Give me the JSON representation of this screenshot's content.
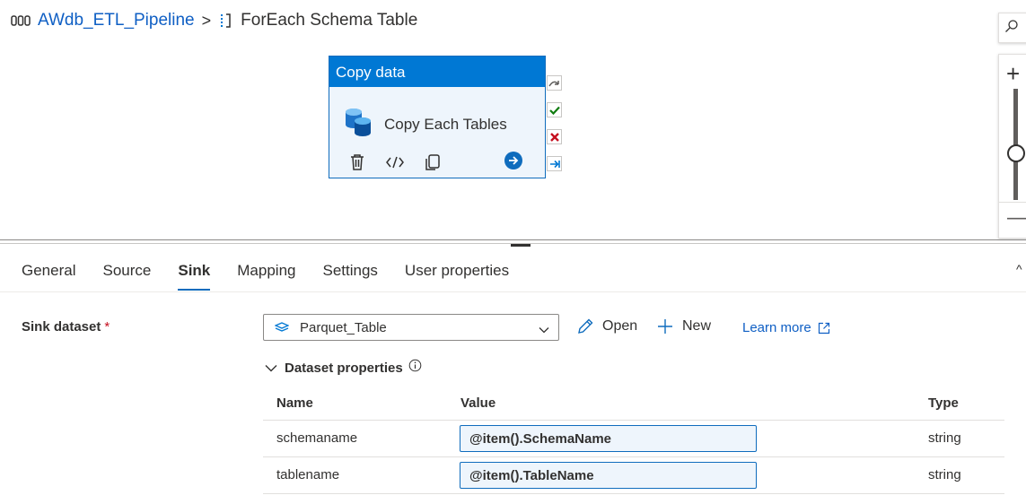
{
  "breadcrumb": {
    "pipeline": "AWdb_ETL_Pipeline",
    "separator": ">",
    "activity": "ForEach Schema Table"
  },
  "canvas": {
    "activity": {
      "type_label": "Copy data",
      "name": "Copy Each Tables"
    }
  },
  "tabs": [
    {
      "label": "General"
    },
    {
      "label": "Source"
    },
    {
      "label": "Sink"
    },
    {
      "label": "Mapping"
    },
    {
      "label": "Settings"
    },
    {
      "label": "User properties"
    }
  ],
  "active_tab": "Sink",
  "sink": {
    "label": "Sink dataset",
    "required_mark": "*",
    "dataset_value": "Parquet_Table",
    "open_label": "Open",
    "new_label": "New",
    "learn_more_label": "Learn more",
    "props_title": "Dataset properties",
    "columns": {
      "name": "Name",
      "value": "Value",
      "type": "Type"
    },
    "rows": [
      {
        "name": "schemaname",
        "value": "@item().SchemaName",
        "type": "string"
      },
      {
        "name": "tablename",
        "value": "@item().TableName",
        "type": "string"
      }
    ]
  },
  "colors": {
    "accent": "#0078d4",
    "link": "#0f5fc4",
    "success": "#107c10",
    "error": "#c50f1f"
  }
}
